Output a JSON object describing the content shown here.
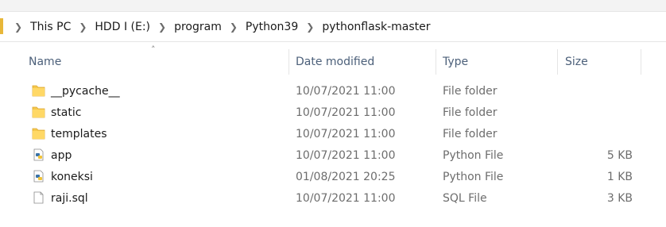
{
  "breadcrumb": {
    "items": [
      "This PC",
      "HDD I (E:)",
      "program",
      "Python39",
      "pythonflask-master"
    ]
  },
  "columns": {
    "name": "Name",
    "date_modified": "Date modified",
    "type": "Type",
    "size": "Size"
  },
  "sort_indicator": "^",
  "files": [
    {
      "name": "__pycache__",
      "date": "10/07/2021 11:00",
      "type": "File folder",
      "size": "",
      "icon": "folder-icon"
    },
    {
      "name": "static",
      "date": "10/07/2021 11:00",
      "type": "File folder",
      "size": "",
      "icon": "folder-icon"
    },
    {
      "name": "templates",
      "date": "10/07/2021 11:00",
      "type": "File folder",
      "size": "",
      "icon": "folder-icon"
    },
    {
      "name": "app",
      "date": "10/07/2021 11:00",
      "type": "Python File",
      "size": "5 KB",
      "icon": "python-file-icon"
    },
    {
      "name": "koneksi",
      "date": "01/08/2021 20:25",
      "type": "Python File",
      "size": "1 KB",
      "icon": "python-file-icon"
    },
    {
      "name": "raji.sql",
      "date": "10/07/2021 11:00",
      "type": "SQL File",
      "size": "3 KB",
      "icon": "document-icon"
    }
  ],
  "colors": {
    "folder": "#f5c84c",
    "header_text": "#4c607a",
    "secondary_text": "#6d6d6d"
  }
}
